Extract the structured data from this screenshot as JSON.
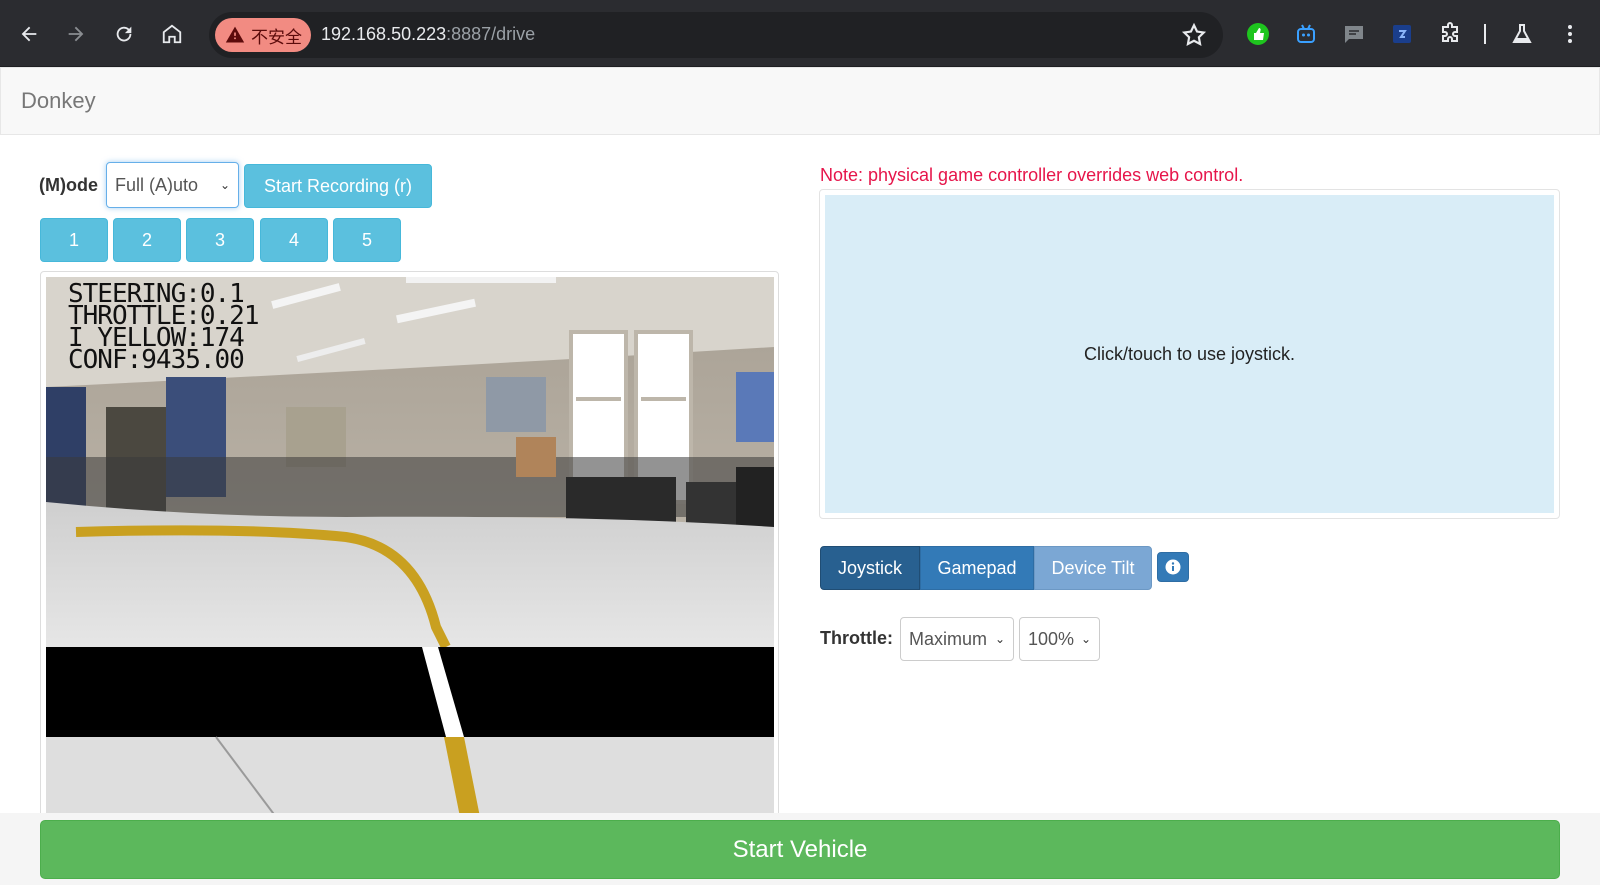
{
  "browser": {
    "security_label": "不安全",
    "url_host": "192.168.50.223",
    "url_rest": ":8887/drive",
    "extensions": [
      "thumbs-up-extension-icon",
      "robot-extension-icon",
      "chat-extension-icon",
      "translate-extension-icon",
      "puzzle-extension-icon",
      "labs-flask-icon",
      "more-vert-icon"
    ]
  },
  "navbar": {
    "brand": "Donkey"
  },
  "controls": {
    "mode_label": "(M)ode",
    "mode_value": "Full (A)uto",
    "record_label": "Start Recording (r)",
    "number_buttons": [
      "1",
      "2",
      "3",
      "4",
      "5"
    ]
  },
  "video": {
    "overlay": {
      "steering": "STEERING:0.1",
      "throttle": "THROTTLE:0.21",
      "yellow": "I YELLOW:174",
      "conf": "CONF:9435.00"
    }
  },
  "right": {
    "note": "Note: physical game controller overrides web control.",
    "joystick_hint": "Click/touch to use joystick.",
    "tabs": {
      "joystick": "Joystick",
      "gamepad": "Gamepad",
      "tilt": "Device Tilt"
    },
    "throttle_label": "Throttle:",
    "throttle_mode": "Maximum",
    "throttle_pct": "100%"
  },
  "footer": {
    "start_label": "Start Vehicle"
  },
  "colors": {
    "info_blue": "#5bc0de",
    "primary_blue": "#337ab7",
    "success_green": "#5cb85c",
    "note_red": "#e6154a",
    "joystick_bg": "#d9edf7"
  }
}
